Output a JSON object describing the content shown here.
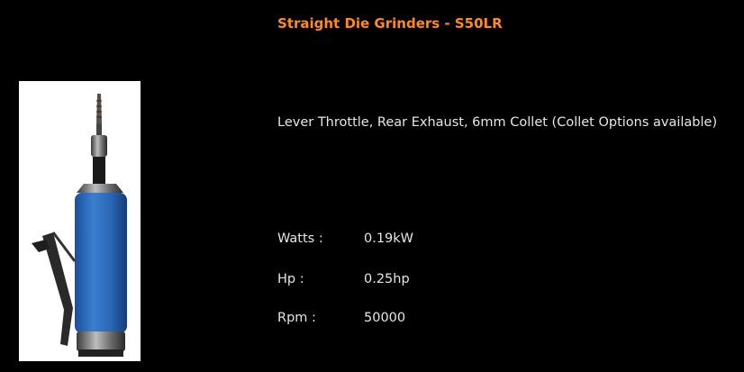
{
  "product": {
    "title": "Straight Die Grinders - S50LR",
    "description": "Lever Throttle, Rear Exhaust, 6mm Collet (Collet Options available)",
    "image_name": "die-grinder-image"
  },
  "specs": [
    {
      "label": "Watts :",
      "value": "0.19kW"
    },
    {
      "label": "Hp :",
      "value": "0.25hp"
    },
    {
      "label": "Rpm :",
      "value": "50000"
    }
  ],
  "colors": {
    "background": "#000000",
    "title": "#ff8c1a",
    "text": "#e6e6e6",
    "tool_body": "#2f6fc0"
  }
}
